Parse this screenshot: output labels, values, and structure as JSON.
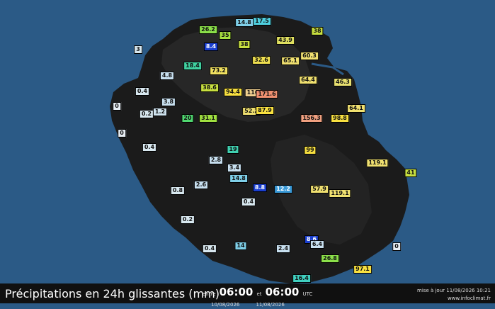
{
  "title": "Précipitations en 24h glissantes (mm)",
  "period": {
    "between_word": "entre",
    "and_word": "et",
    "start_time": "06:00",
    "end_time": "06:00",
    "timezone": "UTC",
    "start_date": "10/08/2026",
    "end_date": "11/08/2026"
  },
  "update_text": "mise à jour 11/08/2026 10:21",
  "site": "www.infoclimat.fr",
  "colors": {
    "ocean": "#2b5a86",
    "land": "#1a1a1a",
    "footer": "#101010"
  },
  "stations": [
    {
      "v": "17.5",
      "c": "#4fd0e0"
    },
    {
      "v": "14.8",
      "c": "#7fcfe8"
    },
    {
      "v": "26.2",
      "c": "#8be04a"
    },
    {
      "v": "35",
      "c": "#a8e040"
    },
    {
      "v": "8.4",
      "c": "#1a3fd0",
      "w": true
    },
    {
      "v": "38",
      "c": "#c8e040"
    },
    {
      "v": "43.9",
      "c": "#e0e060"
    },
    {
      "v": "38",
      "c": "#c8e040"
    },
    {
      "v": "3",
      "c": "#d8e8f0"
    },
    {
      "v": "60.3",
      "c": "#f0e070"
    },
    {
      "v": "32.6",
      "c": "#f0e050"
    },
    {
      "v": "65.1",
      "c": "#f0e070"
    },
    {
      "v": "18.4",
      "c": "#40d0a0"
    },
    {
      "v": "73.2",
      "c": "#f0e060"
    },
    {
      "v": "4.8",
      "c": "#c8e0f0"
    },
    {
      "v": "64.4",
      "c": "#f0e070"
    },
    {
      "v": "46.3",
      "c": "#e8e070"
    },
    {
      "v": "38.6",
      "c": "#c8e040"
    },
    {
      "v": "94.4",
      "c": "#f8e040"
    },
    {
      "v": "116",
      "c": "#f0d090"
    },
    {
      "v": "171.6",
      "c": "#f09070"
    },
    {
      "v": "0.4",
      "c": "#d8e8f0"
    },
    {
      "v": "3.8",
      "c": "#c8e0f0"
    },
    {
      "v": "0",
      "c": "#e8eef4"
    },
    {
      "v": "52.2",
      "c": "#f0e070"
    },
    {
      "v": "87.9",
      "c": "#f8e040"
    },
    {
      "v": "64.1",
      "c": "#f0e070"
    },
    {
      "v": "0.2",
      "c": "#d8e8f0"
    },
    {
      "v": "1.2",
      "c": "#d0e4f0"
    },
    {
      "v": "20",
      "c": "#50d870"
    },
    {
      "v": "31.1",
      "c": "#a0e040"
    },
    {
      "v": "156.3",
      "c": "#f0a080"
    },
    {
      "v": "98.8",
      "c": "#f8e040"
    },
    {
      "v": "0",
      "c": "#e8eef4"
    },
    {
      "v": "0.4",
      "c": "#d8e8f0"
    },
    {
      "v": "19",
      "c": "#40d0b0"
    },
    {
      "v": "99",
      "c": "#f8e040"
    },
    {
      "v": "2.8",
      "c": "#c8e0f0"
    },
    {
      "v": "119.1",
      "c": "#f0e070"
    },
    {
      "v": "3.4",
      "c": "#c8e0f0"
    },
    {
      "v": "41",
      "c": "#c8e040"
    },
    {
      "v": "14.8",
      "c": "#7fcfe8"
    },
    {
      "v": "2.6",
      "c": "#c8e0f0"
    },
    {
      "v": "8.8",
      "c": "#1a3fd0",
      "w": true
    },
    {
      "v": "12.2",
      "c": "#3a9ad8",
      "w": true
    },
    {
      "v": "0.8",
      "c": "#d8e8f0"
    },
    {
      "v": "57.9",
      "c": "#f0e070"
    },
    {
      "v": "119.1",
      "c": "#f0e070"
    },
    {
      "v": "0.4",
      "c": "#d8e8f0"
    },
    {
      "v": "0.2",
      "c": "#d8e8f0"
    },
    {
      "v": "8.6",
      "c": "#1a3fd0",
      "w": true
    },
    {
      "v": "6.4",
      "c": "#c8e0f0"
    },
    {
      "v": "0.4",
      "c": "#d8e8f0"
    },
    {
      "v": "14",
      "c": "#7fcfe8"
    },
    {
      "v": "2.4",
      "c": "#c8e0f0"
    },
    {
      "v": "0",
      "c": "#e8eef4"
    },
    {
      "v": "26.8",
      "c": "#8be04a"
    },
    {
      "v": "97.1",
      "c": "#f8e040"
    },
    {
      "v": "16.4",
      "c": "#40d0c0"
    }
  ]
}
